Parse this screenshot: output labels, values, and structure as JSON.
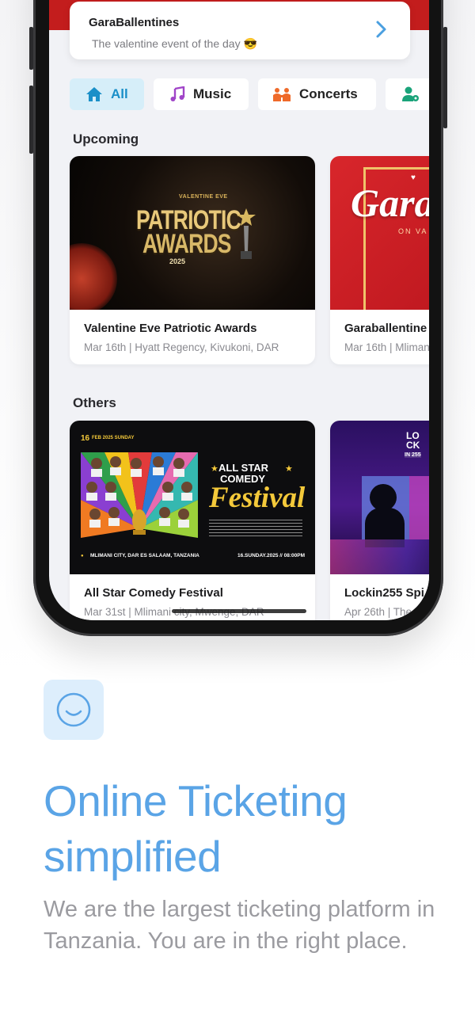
{
  "app": {
    "promo": {
      "title": "GaraBallentines",
      "subtitle": "The valentine event of the day",
      "emoji": "😎"
    },
    "chips": [
      {
        "label": "All",
        "icon": "home-icon",
        "active": true
      },
      {
        "label": "Music",
        "icon": "music-note-icon",
        "active": false
      },
      {
        "label": "Concerts",
        "icon": "concert-icon",
        "active": false
      },
      {
        "label": "",
        "icon": "user-settings-icon",
        "active": false
      }
    ],
    "sections": {
      "upcoming": {
        "title": "Upcoming",
        "events": [
          {
            "title": "Valentine Eve Patriotic Awards",
            "meta": "Mar 16th | Hyatt Regency, Kivukoni, DAR",
            "poster": {
              "kicker": "VALENTINE EVE",
              "line1": "PATRIOTIC",
              "line2": "AWARDS",
              "year": "2025"
            }
          },
          {
            "title": "Garaballentine",
            "meta": "Mar 16th | Mliman",
            "poster": {
              "script": "Gara",
              "small": "ON VA"
            }
          }
        ]
      },
      "others": {
        "title": "Others",
        "events": [
          {
            "title": "All Star Comedy Festival",
            "meta": "Mar 31st | Mlimani city, Mwenge, DAR",
            "poster": {
              "date": "16",
              "date_sub": "FEB 2025 SUNDAY",
              "line1": "ALL STAR",
              "line2": "COMEDY",
              "line3": "Festival",
              "venue": "MLIMANI CITY, DAR ES SALAAM, TANZANIA",
              "time": "16.SUNDAY.2025 // 08:00PM"
            }
          },
          {
            "title": "Lockin255 Spi",
            "meta": "Apr 26th | The",
            "poster": {
              "line1": "LO",
              "line2": "CK",
              "line3": "IN 255"
            }
          }
        ]
      }
    }
  },
  "feature": {
    "icon": "smile-icon",
    "headline_line1": "Online Ticketing",
    "headline_line2": "simplified",
    "body": "We are the largest ticketing platform in Tanzania. You are in the right place."
  },
  "colors": {
    "brand_blue": "#5aa4e6",
    "chip_active_bg": "#d6eef9",
    "chip_active_text": "#1a8fc8",
    "chevron": "#4a9fe0"
  }
}
